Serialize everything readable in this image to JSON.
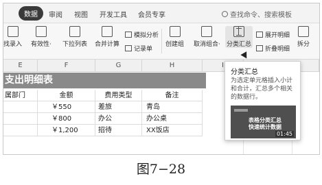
{
  "tabs": [
    "数据",
    "审阅",
    "视图",
    "开发工具",
    "会员专享"
  ],
  "search_placeholder": "查找命令、搜索模板",
  "ribbon": {
    "left_buttons": [
      "找录入",
      "有效性·",
      "下拉列表",
      "合并计算"
    ],
    "small_buttons": [
      "模拟分析",
      "记录单"
    ],
    "group_buttons": [
      "创建组",
      "取消组合·",
      "分类汇总"
    ],
    "outline_buttons": [
      "展开明细",
      "折叠明细"
    ],
    "split_button": "拆分"
  },
  "sheet": {
    "column_headers": [
      "E",
      "F",
      "G",
      "H",
      "I"
    ],
    "table_title": "支出明细表",
    "headers": [
      "属部门",
      "金额",
      "费用类型",
      "备注"
    ],
    "rows": [
      [
        "",
        "￥550",
        "差旅",
        "青岛"
      ],
      [
        "",
        "￥800",
        "办公",
        "办公桌"
      ],
      [
        "",
        "￥1,200",
        "招待",
        "XX饭店"
      ]
    ]
  },
  "tooltip": {
    "title": "分类汇总",
    "description": "为选定单元格插入小计和合计，汇总多个相关的数据行。",
    "video_line1": "表格分类汇总",
    "video_line2": "快速统计数据",
    "video_duration": "01:45"
  },
  "caption": "图7−28"
}
